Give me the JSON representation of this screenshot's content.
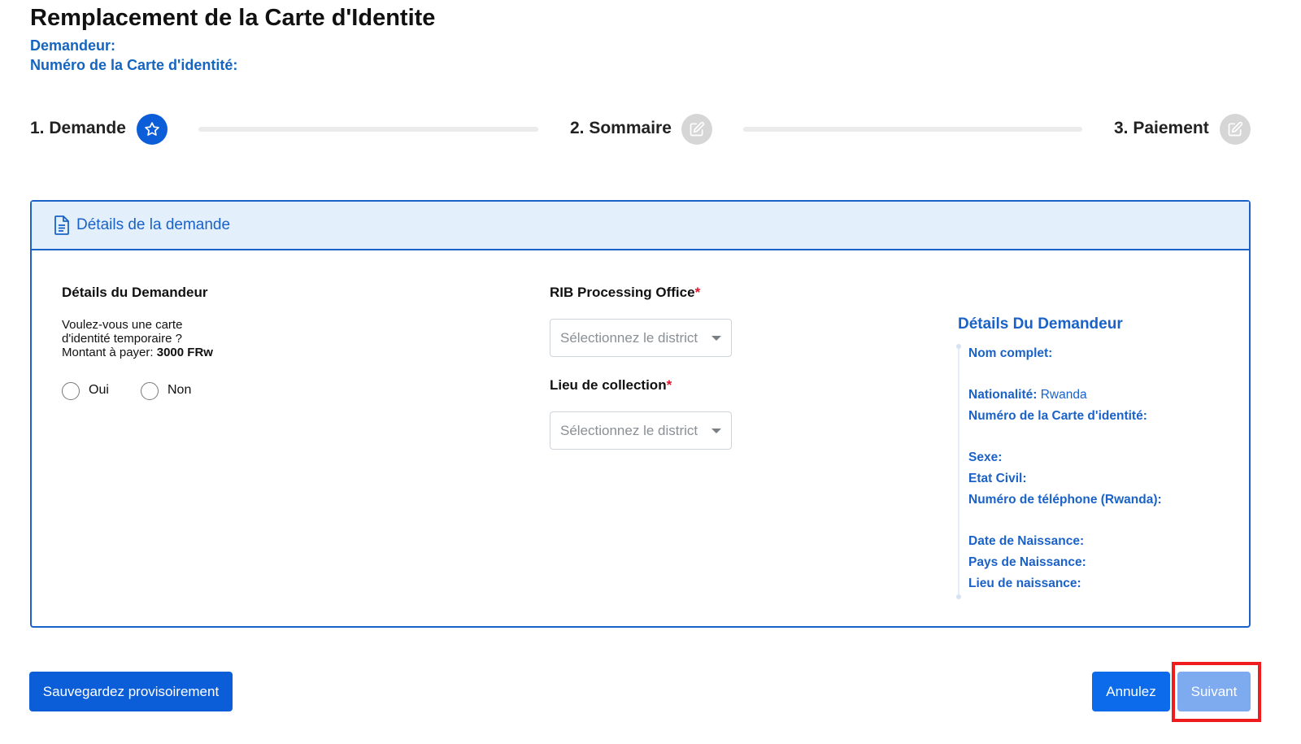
{
  "page": {
    "title": "Remplacement de la Carte d'Identite",
    "requester_label": "Demandeur:",
    "id_number_label": "Numéro de la Carte d'identité:"
  },
  "stepper": {
    "steps": [
      {
        "label": "1. Demande",
        "state": "active",
        "icon": "star-icon"
      },
      {
        "label": "2. Sommaire",
        "state": "inactive",
        "icon": "edit-icon"
      },
      {
        "label": "3. Paiement",
        "state": "inactive",
        "icon": "edit-icon"
      }
    ]
  },
  "card": {
    "header_title": "Détails de la demande",
    "header_icon": "document-icon",
    "applicant": {
      "section_title": "Détails du Demandeur",
      "question_line1": "Voulez-vous une carte",
      "question_line2": "d'identité temporaire ?",
      "amount_label": "Montant à payer:",
      "amount_value": "3000 FRw",
      "options": [
        "Oui",
        "Non"
      ]
    },
    "processing": {
      "office_label": "RIB Processing Office",
      "office_placeholder": "Sélectionnez le district",
      "collection_label": "Lieu de collection",
      "collection_placeholder": "Sélectionnez le district",
      "required_mark": "*"
    },
    "details": {
      "heading": "Détails Du Demandeur",
      "items": [
        {
          "label": "Nom complet:",
          "value": ""
        },
        {
          "label": "Nationalité:",
          "value": "Rwanda"
        },
        {
          "label": "Numéro de la Carte d'identité:",
          "value": ""
        },
        {
          "label": "Sexe:",
          "value": ""
        },
        {
          "label": "Etat Civil:",
          "value": ""
        },
        {
          "label": "Numéro de téléphone (Rwanda):",
          "value": ""
        },
        {
          "label": "Date de Naissance:",
          "value": ""
        },
        {
          "label": "Pays de Naissance:",
          "value": ""
        },
        {
          "label": "Lieu de naissance:",
          "value": ""
        }
      ]
    }
  },
  "actions": {
    "save_label": "Sauvegardez provisoirement",
    "cancel_label": "Annulez",
    "next_label": "Suivant"
  },
  "colors": {
    "primary": "#0b5ed7",
    "link_blue": "#1a62c8",
    "header_bg": "#e3f0fb",
    "required": "#e0142c",
    "highlight": "#ee1c1c"
  }
}
